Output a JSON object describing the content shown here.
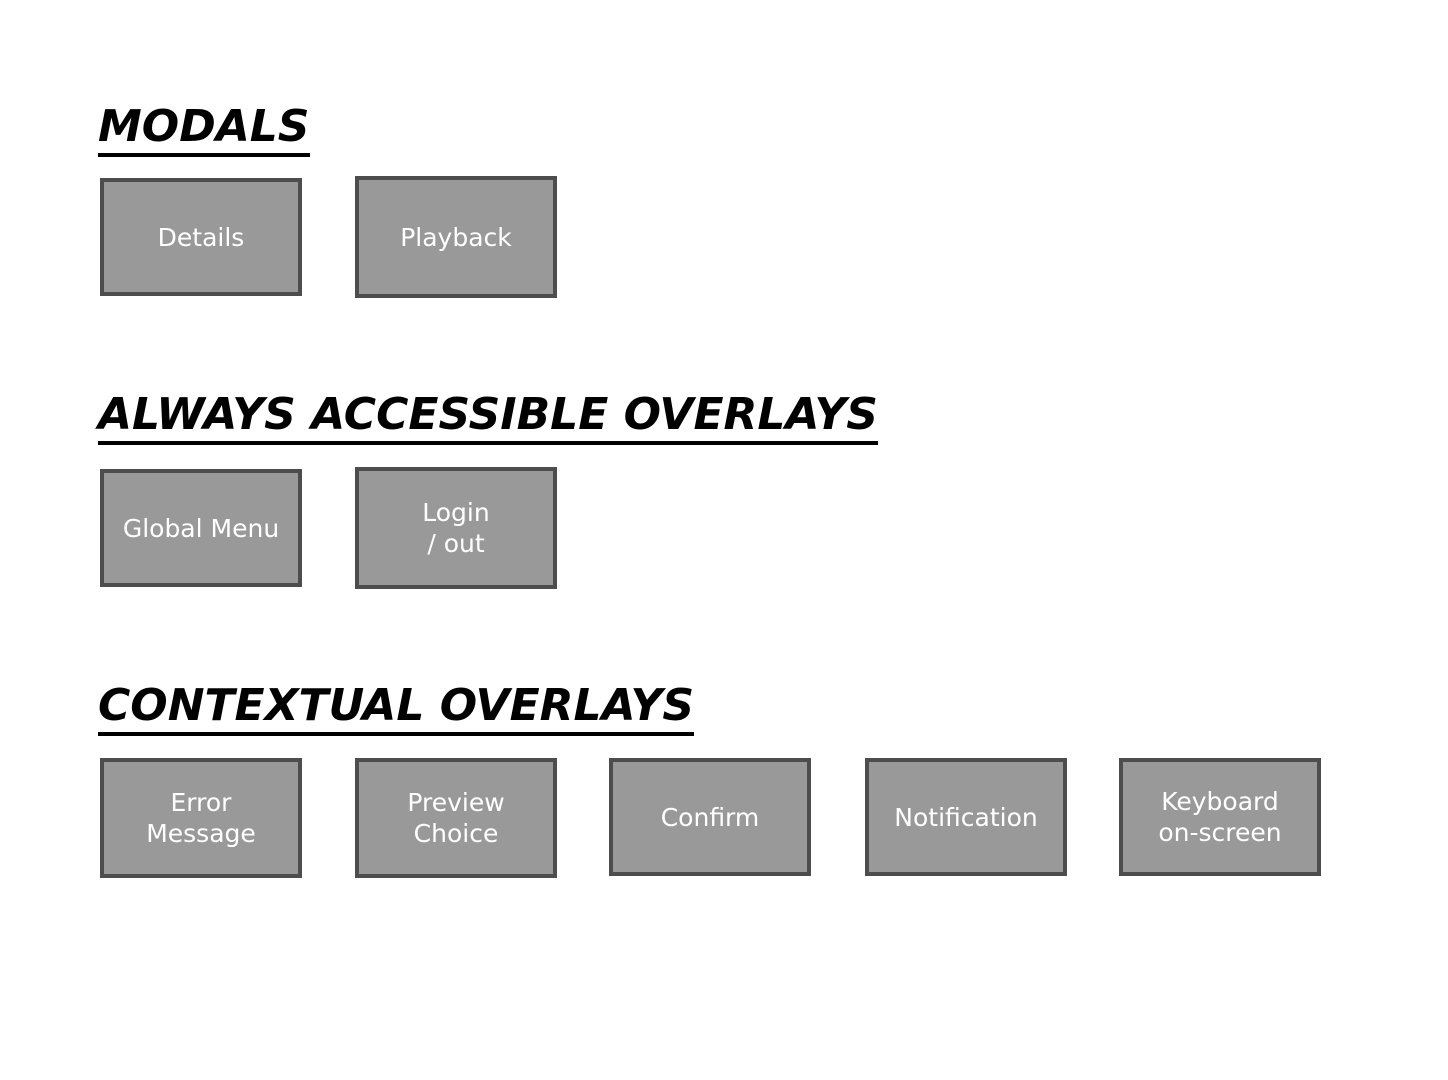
{
  "page": {
    "background_color": "#ffffff",
    "box_fill_color": "#999999",
    "box_border_color": "#4d4d4d",
    "box_label_color": "#ffffff",
    "heading_color": "#000000"
  },
  "sections": [
    {
      "id": "modals",
      "heading": "MODALS",
      "boxes": [
        {
          "id": "details",
          "label": "Details"
        },
        {
          "id": "playback",
          "label": "Playback"
        }
      ]
    },
    {
      "id": "always-accessible-overlays",
      "heading": "ALWAYS ACCESSIBLE OVERLAYS",
      "boxes": [
        {
          "id": "global-menu",
          "label": "Global Menu"
        },
        {
          "id": "login-out",
          "label": "Login\n/ out"
        }
      ]
    },
    {
      "id": "contextual-overlays",
      "heading": "CONTEXTUAL OVERLAYS",
      "boxes": [
        {
          "id": "error-message",
          "label": "Error\nMessage"
        },
        {
          "id": "preview-choice",
          "label": "Preview\nChoice"
        },
        {
          "id": "confirm",
          "label": "Confirm"
        },
        {
          "id": "notification",
          "label": "Notification"
        },
        {
          "id": "keyboard-on-screen",
          "label": "Keyboard\non-screen"
        }
      ]
    }
  ]
}
